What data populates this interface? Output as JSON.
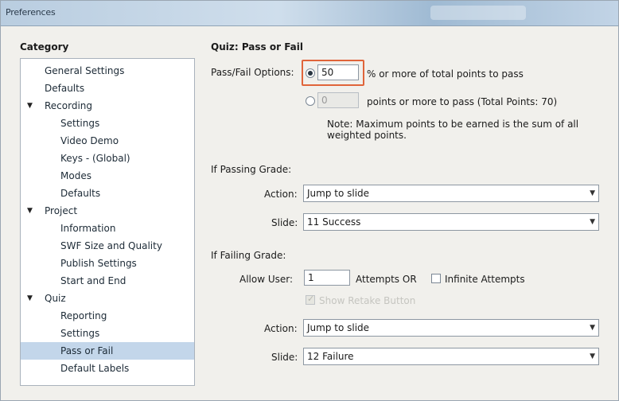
{
  "window": {
    "title": "Preferences"
  },
  "category": {
    "heading": "Category",
    "items": [
      {
        "label": "General Settings",
        "level": 1,
        "expanded": null
      },
      {
        "label": "Defaults",
        "level": 1,
        "expanded": null
      },
      {
        "label": "Recording",
        "level": 1,
        "expanded": true
      },
      {
        "label": "Settings",
        "level": 2,
        "expanded": null
      },
      {
        "label": "Video Demo",
        "level": 2,
        "expanded": null
      },
      {
        "label": "Keys - (Global)",
        "level": 2,
        "expanded": null
      },
      {
        "label": "Modes",
        "level": 2,
        "expanded": null
      },
      {
        "label": "Defaults",
        "level": 2,
        "expanded": null
      },
      {
        "label": "Project",
        "level": 1,
        "expanded": true
      },
      {
        "label": "Information",
        "level": 2,
        "expanded": null
      },
      {
        "label": "SWF Size and Quality",
        "level": 2,
        "expanded": null
      },
      {
        "label": "Publish Settings",
        "level": 2,
        "expanded": null
      },
      {
        "label": "Start and End",
        "level": 2,
        "expanded": null
      },
      {
        "label": "Quiz",
        "level": 1,
        "expanded": true
      },
      {
        "label": "Reporting",
        "level": 2,
        "expanded": null
      },
      {
        "label": "Settings",
        "level": 2,
        "expanded": null
      },
      {
        "label": "Pass or Fail",
        "level": 2,
        "expanded": null,
        "selected": true
      },
      {
        "label": "Default Labels",
        "level": 2,
        "expanded": null
      }
    ]
  },
  "panel": {
    "title": "Quiz: Pass or Fail",
    "pass_fail_options_label": "Pass/Fail Options:",
    "percent_value": "50",
    "percent_suffix": "% or more of total points to pass",
    "points_value": "0",
    "points_suffix": "points or more to pass (Total Points: 70)",
    "note": "Note:  Maximum points to be earned is the sum of all weighted points.",
    "passing_heading": "If Passing Grade:",
    "passing_action_label": "Action:",
    "passing_action_value": "Jump to slide",
    "passing_slide_label": "Slide:",
    "passing_slide_value": "11 Success",
    "failing_heading": "If Failing Grade:",
    "allow_user_label": "Allow User:",
    "attempts_value": "1",
    "attempts_or_label": "Attempts  OR",
    "infinite_attempts_label": "Infinite Attempts",
    "show_retake_label": "Show Retake Button",
    "failing_action_label": "Action:",
    "failing_action_value": "Jump to slide",
    "failing_slide_label": "Slide:",
    "failing_slide_value": "12 Failure"
  },
  "colors": {
    "selection": "#c3d6ea",
    "highlight_box": "#e0643a"
  }
}
